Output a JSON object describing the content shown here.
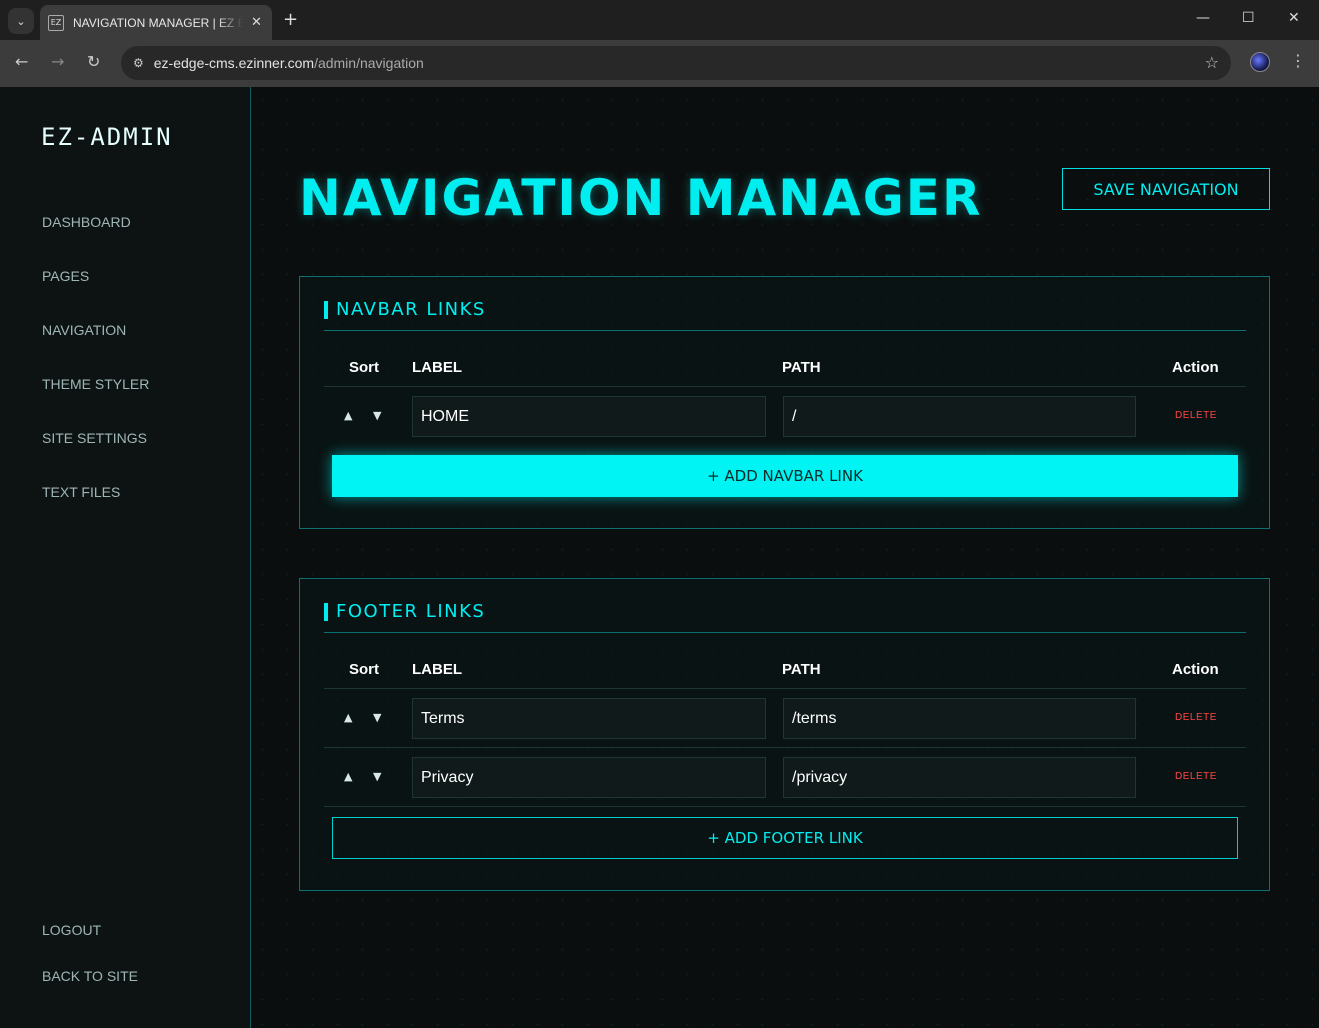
{
  "browser": {
    "tab_title": "NAVIGATION MANAGER | EZ EDGE CMS",
    "url_host": "ez-edge-cms.ezinner.com",
    "url_path": "/admin/navigation"
  },
  "sidebar": {
    "brand": "EZ-ADMIN",
    "items": [
      {
        "label": "DASHBOARD"
      },
      {
        "label": "PAGES"
      },
      {
        "label": "NAVIGATION"
      },
      {
        "label": "THEME STYLER"
      },
      {
        "label": "SITE SETTINGS"
      },
      {
        "label": "TEXT FILES"
      }
    ],
    "bottom_items": [
      {
        "label": "LOGOUT"
      },
      {
        "label": "BACK TO SITE"
      }
    ]
  },
  "header": {
    "title": "NAVIGATION MANAGER",
    "save_label": "SAVE NAVIGATION"
  },
  "table_headers": {
    "sort": "Sort",
    "label": "LABEL",
    "path": "PATH",
    "action": "Action"
  },
  "navbar": {
    "title": "NAVBAR LINKS",
    "rows": [
      {
        "label": "HOME",
        "path": "/",
        "delete": "DELETE"
      }
    ],
    "add_label": "+ ADD NAVBAR LINK"
  },
  "footer": {
    "title": "FOOTER LINKS",
    "rows": [
      {
        "label": "Terms",
        "path": "/terms",
        "delete": "DELETE"
      },
      {
        "label": "Privacy",
        "path": "/privacy",
        "delete": "DELETE"
      }
    ],
    "add_label": "+ ADD FOOTER LINK"
  },
  "colors": {
    "accent": "#00eef0",
    "danger": "#ff4444",
    "sidebar_bg": "#0d1313",
    "page_bg": "#0b0e0e"
  },
  "icons": {
    "sort_up": "▲",
    "sort_down": "▼"
  }
}
